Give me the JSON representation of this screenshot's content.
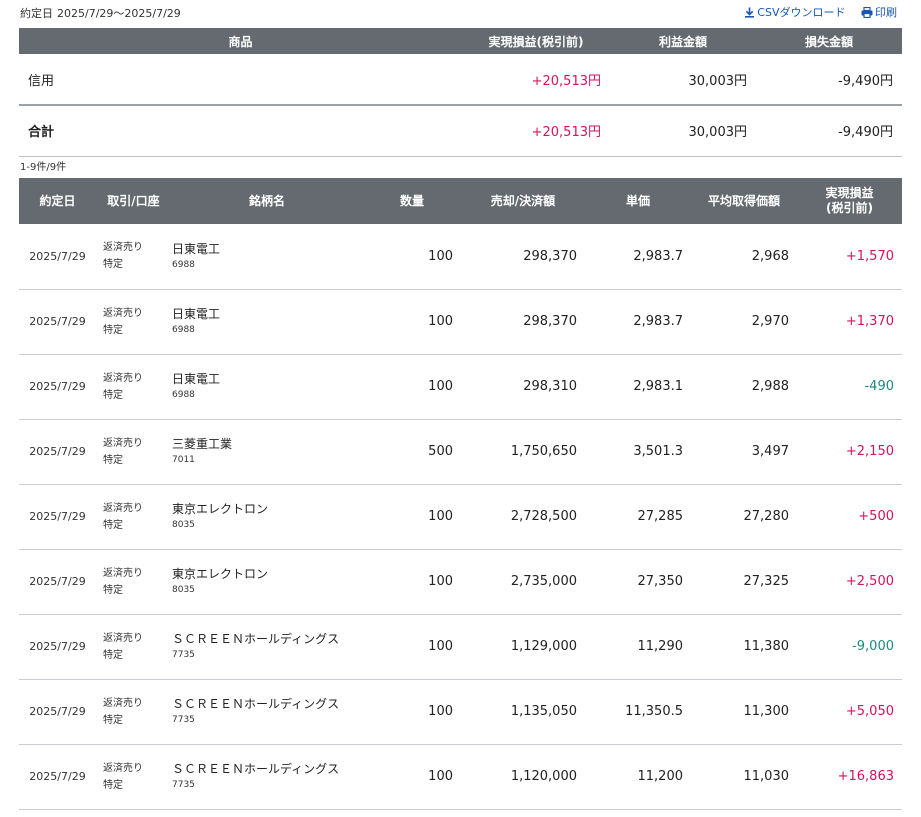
{
  "header": {
    "period_label": "約定日",
    "period_value": "2025/7/29〜2025/7/29",
    "csv_label": "CSVダウンロード",
    "print_label": "印刷"
  },
  "summary": {
    "columns": [
      "商品",
      "実現損益(税引前)",
      "利益金額",
      "損失金額"
    ],
    "rows": [
      {
        "name": "信用",
        "realized": "+20,513円",
        "profit": "30,003円",
        "loss": "-9,490円"
      },
      {
        "name": "合計",
        "realized": "+20,513円",
        "profit": "30,003円",
        "loss": "-9,490円"
      }
    ]
  },
  "count_text": "1-9件/9件",
  "detail": {
    "columns": [
      "約定日",
      "取引/口座",
      "銘柄名",
      "数量",
      "売却/決済額",
      "単価",
      "平均取得価額",
      "実現損益",
      "(税引前)"
    ],
    "rows": [
      {
        "date": "2025/7/29",
        "trade": "返済売り",
        "account": "特定",
        "name": "日東電工",
        "code": "6988",
        "qty": "100",
        "amount": "298,370",
        "price": "2,983.7",
        "avg": "2,968",
        "pnl": "+1,570"
      },
      {
        "date": "2025/7/29",
        "trade": "返済売り",
        "account": "特定",
        "name": "日東電工",
        "code": "6988",
        "qty": "100",
        "amount": "298,370",
        "price": "2,983.7",
        "avg": "2,970",
        "pnl": "+1,370"
      },
      {
        "date": "2025/7/29",
        "trade": "返済売り",
        "account": "特定",
        "name": "日東電工",
        "code": "6988",
        "qty": "100",
        "amount": "298,310",
        "price": "2,983.1",
        "avg": "2,988",
        "pnl": "-490"
      },
      {
        "date": "2025/7/29",
        "trade": "返済売り",
        "account": "特定",
        "name": "三菱重工業",
        "code": "7011",
        "qty": "500",
        "amount": "1,750,650",
        "price": "3,501.3",
        "avg": "3,497",
        "pnl": "+2,150"
      },
      {
        "date": "2025/7/29",
        "trade": "返済売り",
        "account": "特定",
        "name": "東京エレクトロン",
        "code": "8035",
        "qty": "100",
        "amount": "2,728,500",
        "price": "27,285",
        "avg": "27,280",
        "pnl": "+500"
      },
      {
        "date": "2025/7/29",
        "trade": "返済売り",
        "account": "特定",
        "name": "東京エレクトロン",
        "code": "8035",
        "qty": "100",
        "amount": "2,735,000",
        "price": "27,350",
        "avg": "27,325",
        "pnl": "+2,500"
      },
      {
        "date": "2025/7/29",
        "trade": "返済売り",
        "account": "特定",
        "name": "ＳＣＲＥＥＮホールディングス",
        "code": "7735",
        "qty": "100",
        "amount": "1,129,000",
        "price": "11,290",
        "avg": "11,380",
        "pnl": "-9,000"
      },
      {
        "date": "2025/7/29",
        "trade": "返済売り",
        "account": "特定",
        "name": "ＳＣＲＥＥＮホールディングス",
        "code": "7735",
        "qty": "100",
        "amount": "1,135,050",
        "price": "11,350.5",
        "avg": "11,300",
        "pnl": "+5,050"
      },
      {
        "date": "2025/7/29",
        "trade": "返済売り",
        "account": "特定",
        "name": "ＳＣＲＥＥＮホールディングス",
        "code": "7735",
        "qty": "100",
        "amount": "1,120,000",
        "price": "11,200",
        "avg": "11,030",
        "pnl": "+16,863"
      }
    ]
  },
  "colors": {
    "header_bg": "#646a70",
    "profit": "#d3135e",
    "loss": "#1e8a7a",
    "link": "#1a56b0"
  }
}
